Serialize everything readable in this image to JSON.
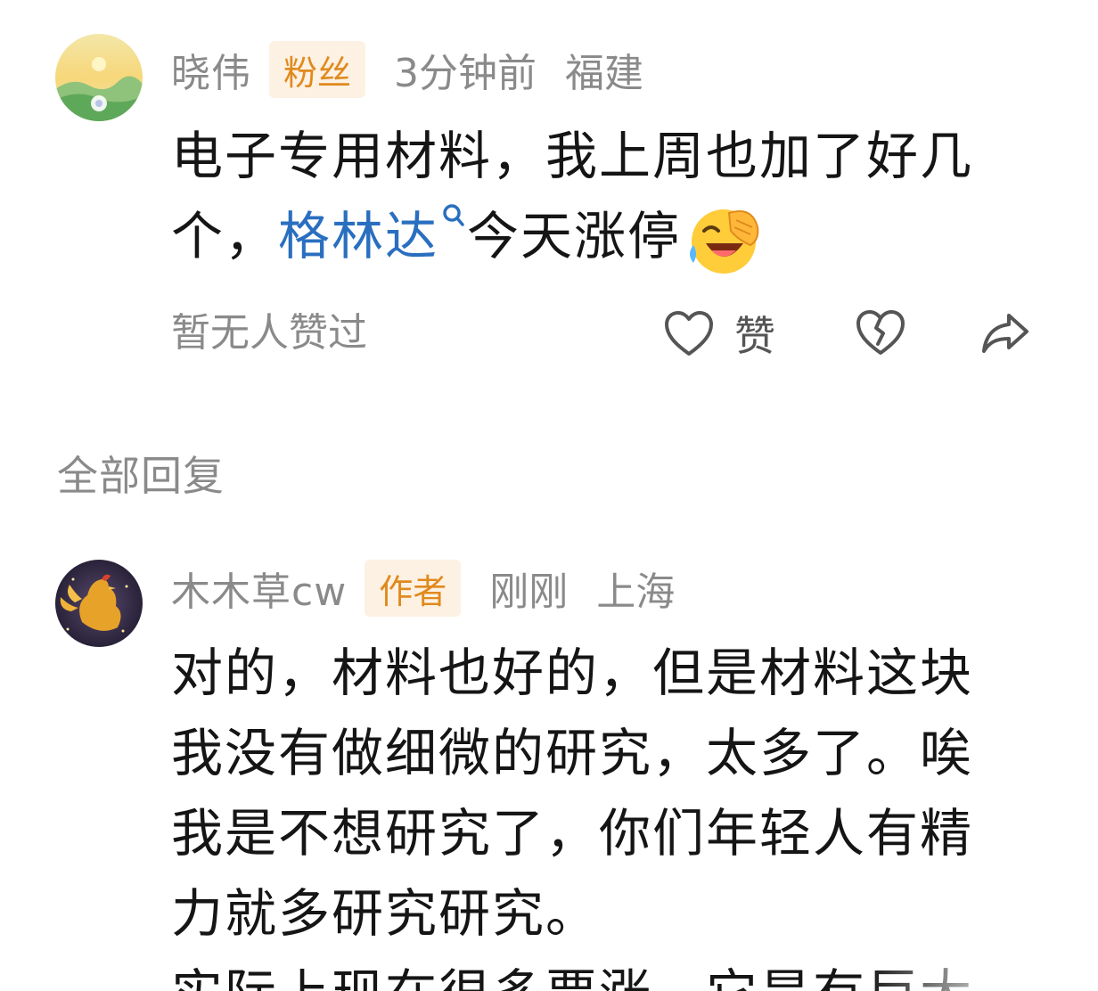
{
  "comment": {
    "username": "晓伟",
    "badge": "粉丝",
    "time": "3分钟前",
    "location": "福建",
    "text_line1": "电子专用材料，我上周也加了好几",
    "text_line2_prefix": "个，",
    "link_text": "格林达",
    "text_line2_suffix": "今天涨停",
    "emoji": "rolling-on-floor-laughing",
    "no_likes_text": "暂无人赞过",
    "like_label": "赞"
  },
  "replies_section": {
    "title": "全部回复"
  },
  "reply": {
    "username": "木木草cw",
    "badge": "作者",
    "time": "刚刚",
    "location": "上海",
    "lines": [
      "对的，材料也好的，但是材料这块",
      "我没有做细微的研究，太多了。唉",
      "我是不想研究了，你们年轻人有精",
      "力就多研究研究。",
      "实际上现在很多票涨，它是有巨大"
    ]
  },
  "colors": {
    "meta_gray": "#8a8a8a",
    "badge_bg": "#fdf1e3",
    "badge_text": "#e08a1e",
    "link_blue": "#2a6fbf"
  }
}
